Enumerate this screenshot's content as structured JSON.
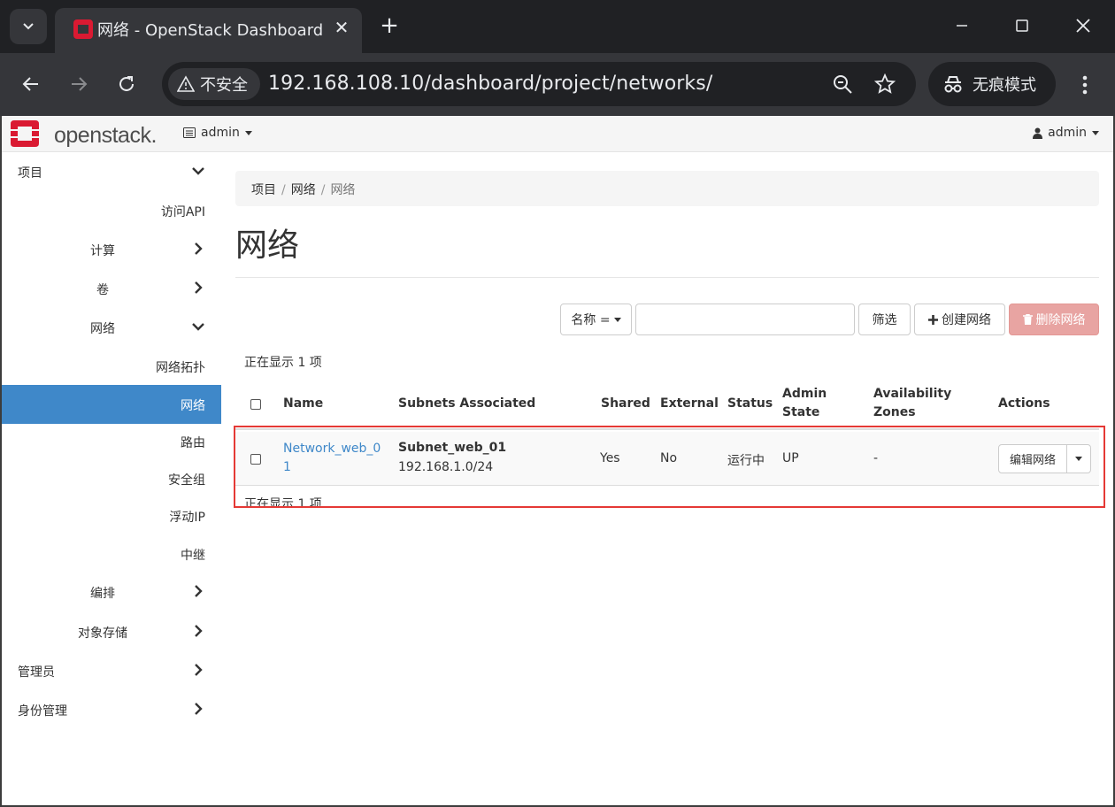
{
  "browser": {
    "tab_title": "网络 - OpenStack Dashboard",
    "security_label": "不安全",
    "url": "192.168.108.10/dashboard/project/networks/",
    "incognito_label": "无痕模式"
  },
  "navbar": {
    "logo_text": "openstack.",
    "project": "admin",
    "user": "admin"
  },
  "sidebar": {
    "items": [
      {
        "label": "项目"
      },
      {
        "label": "访问API"
      },
      {
        "label": "计算"
      },
      {
        "label": "卷"
      },
      {
        "label": "网络"
      },
      {
        "label": "网络拓扑"
      },
      {
        "label": "网络"
      },
      {
        "label": "路由"
      },
      {
        "label": "安全组"
      },
      {
        "label": "浮动IP"
      },
      {
        "label": "中继"
      },
      {
        "label": "编排"
      },
      {
        "label": "对象存储"
      },
      {
        "label": "管理员"
      },
      {
        "label": "身份管理"
      }
    ]
  },
  "breadcrumb": [
    "项目",
    "网络",
    "网络"
  ],
  "page_title": "网络",
  "toolbar": {
    "filter_field": "名称 =",
    "filter_placeholder": "",
    "filter_button": "筛选",
    "create_button": "创建网络",
    "delete_button": "删除网络"
  },
  "table": {
    "count_text": "正在显示 1 项",
    "headers": {
      "name": "Name",
      "subnets": "Subnets Associated",
      "shared": "Shared",
      "external": "External",
      "status": "Status",
      "admin_state_1": "Admin",
      "admin_state_2": "State",
      "az_1": "Availability",
      "az_2": "Zones",
      "actions": "Actions"
    },
    "rows": [
      {
        "name_1": "Network_web_0",
        "name_2": "1",
        "subnet_name": "Subnet_web_01",
        "subnet_cidr": "192.168.1.0/24",
        "shared": "Yes",
        "external": "No",
        "status": "运行中",
        "admin_state": "UP",
        "az": "-",
        "action": "编辑网络"
      }
    ]
  },
  "colors": {
    "accent": "#3f88c9",
    "danger_disabled": "#e8a4a2",
    "highlight": "#e53935",
    "logo_red": "#da1a32"
  }
}
